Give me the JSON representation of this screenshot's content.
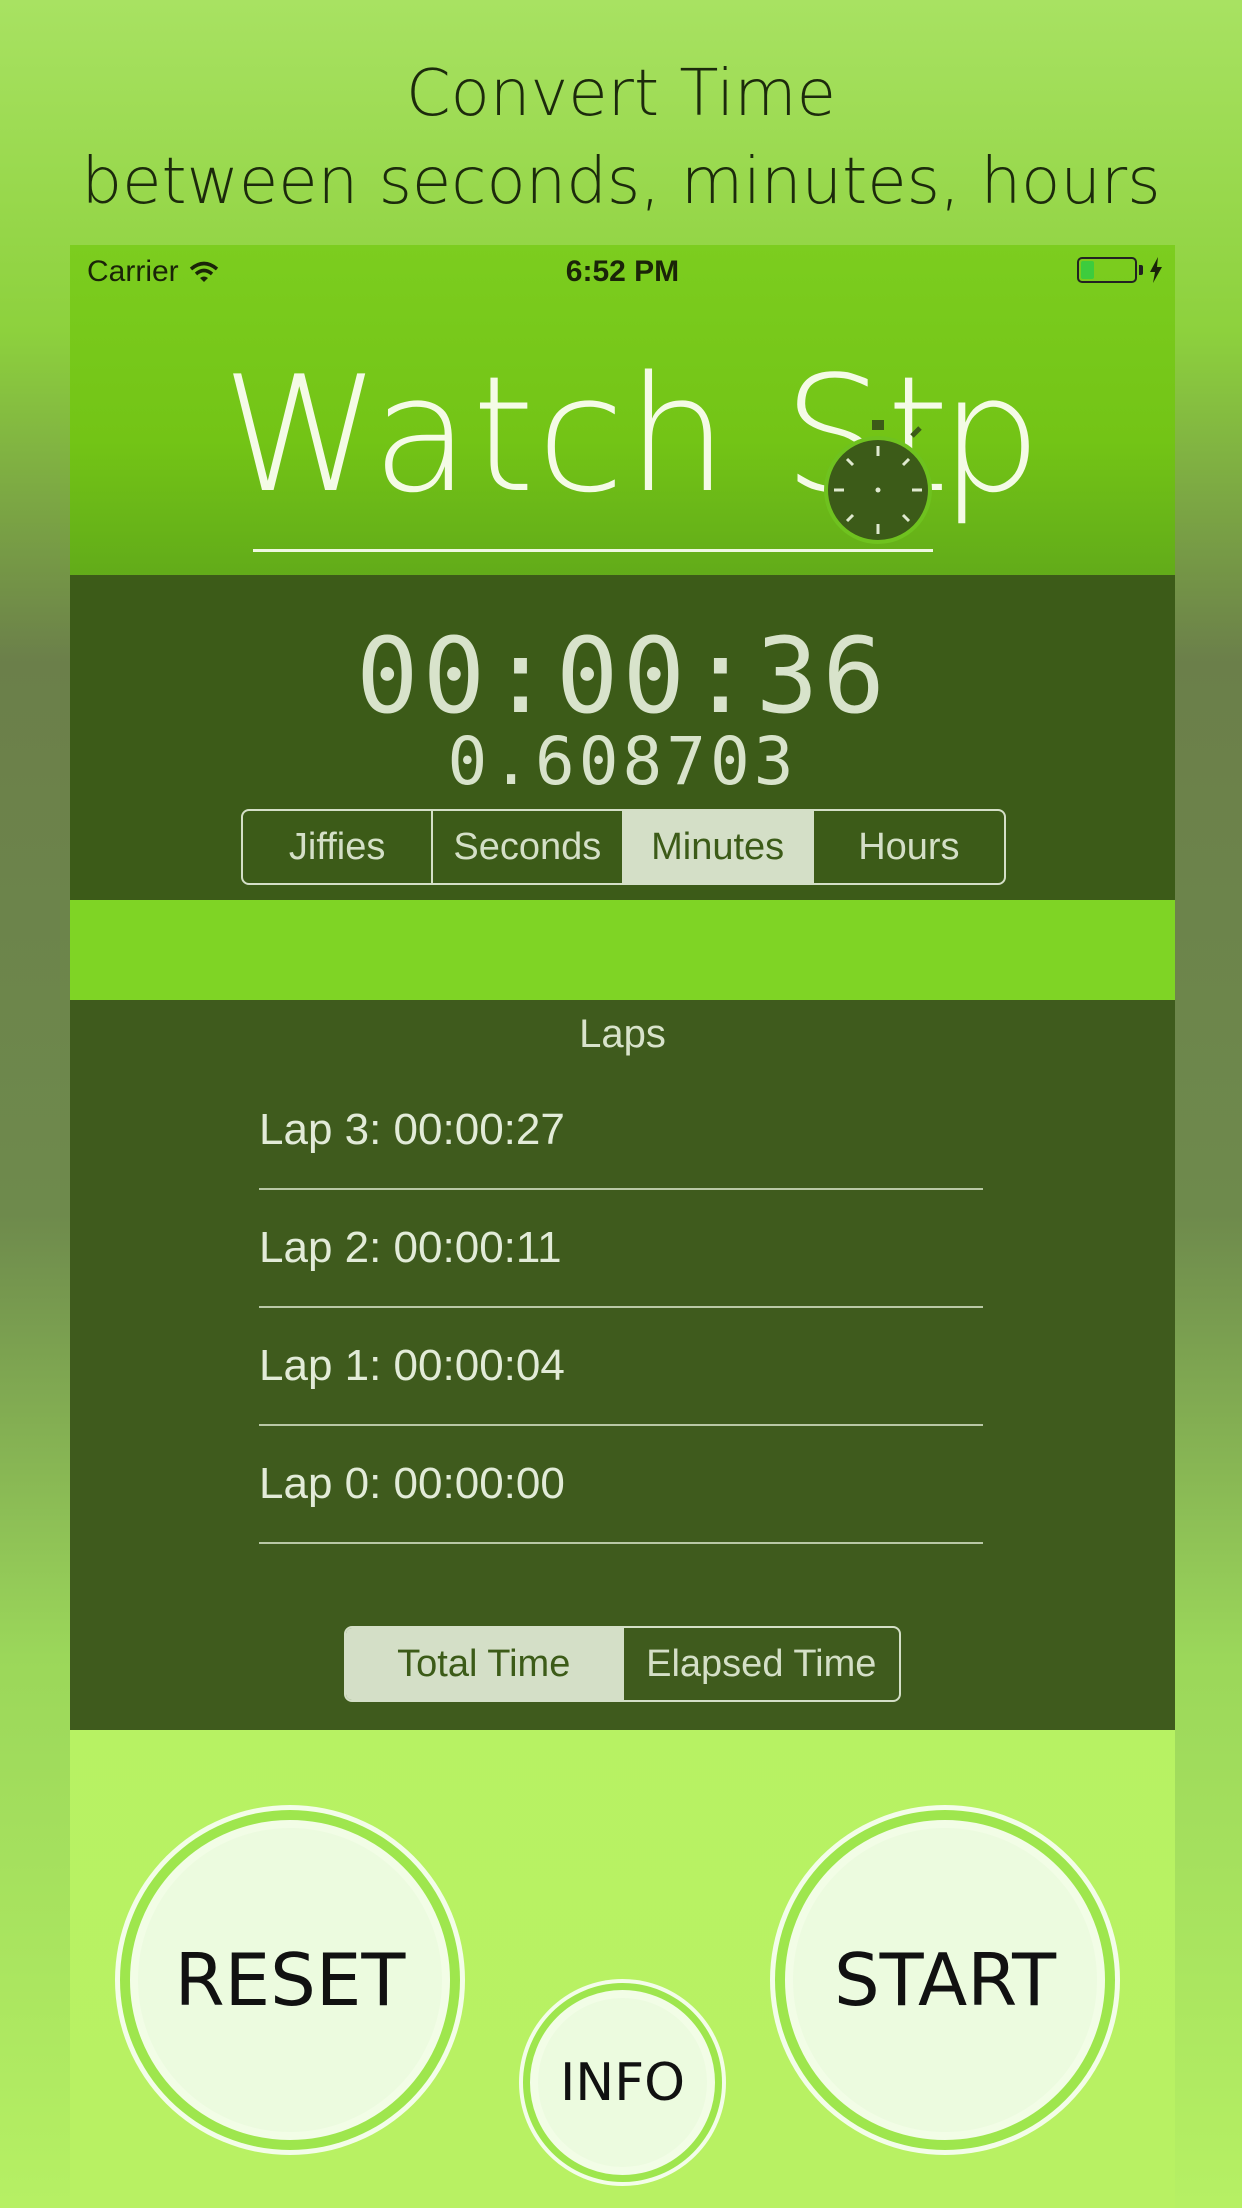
{
  "headline": {
    "line1": "Convert Time",
    "line2": "between seconds, minutes, hours"
  },
  "status_bar": {
    "carrier": "Carrier",
    "time": "6:52 PM",
    "battery_level": 0.25
  },
  "logo": {
    "text": "Watch St",
    "tail": "p"
  },
  "timer": {
    "main": "00:00:36",
    "converted": "0.608703",
    "units": [
      {
        "label": "Jiffies",
        "active": false
      },
      {
        "label": "Seconds",
        "active": false
      },
      {
        "label": "Minutes",
        "active": true
      },
      {
        "label": "Hours",
        "active": false
      }
    ]
  },
  "laps": {
    "title": "Laps",
    "items": [
      {
        "label": "Lap 3: 00:00:27"
      },
      {
        "label": "Lap 2: 00:00:11"
      },
      {
        "label": "Lap 1: 00:00:04"
      },
      {
        "label": "Lap 0: 00:00:00"
      }
    ],
    "modes": [
      {
        "label": "Total Time",
        "active": true
      },
      {
        "label": "Elapsed Time",
        "active": false
      }
    ]
  },
  "buttons": {
    "reset": "RESET",
    "start": "START",
    "info": "INFO"
  },
  "colors": {
    "panel_dark": "#3c5b18",
    "accent_green": "#7fd425",
    "button_fill": "#ecfbdf"
  }
}
